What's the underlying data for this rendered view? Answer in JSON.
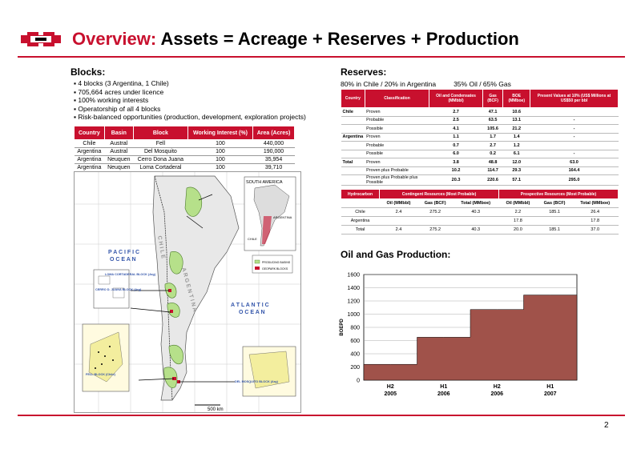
{
  "header": {
    "title_prefix": "Overview:",
    "title_rest": " Assets = Acreage + Reserves + Production",
    "accent_color": "#c8102e"
  },
  "blocks": {
    "title": "Blocks:",
    "bullets": [
      "4 blocks (3 Argentina, 1 Chile)",
      "705,664 acres under licence",
      "100% working interests",
      "Operatorship of all 4 blocks",
      "Risk-balanced opportunities (production, development, exploration projects)"
    ],
    "table": {
      "headers": [
        "Country",
        "Basin",
        "Block",
        "Working Interest (%)",
        "Area (Acres)"
      ],
      "rows": [
        [
          "Chile",
          "Austral",
          "Fell",
          "100",
          "440,000"
        ],
        [
          "Argentina",
          "Austral",
          "Del Mosquito",
          "100",
          "190,000"
        ],
        [
          "Argentina",
          "Neuquen",
          "Cerro Dona Juana",
          "100",
          "35,954"
        ],
        [
          "Argentina",
          "Neuquen",
          "Loma Cortaderal",
          "100",
          "39,710"
        ]
      ]
    }
  },
  "map": {
    "labels": {
      "south_america": "SOUTH AMERICA",
      "argentina_inset": "ARGENTINA",
      "chile_inset": "CHILE",
      "pacific": "P A C I F I C",
      "pacific2": "O C E A N",
      "atlantic": "A T L A N T I C",
      "atlantic2": "O C E A N",
      "chile": "C H I L E",
      "argentina": "A R G E N T I N A",
      "loma": "LOMA CORTADERAL BLOCK (Arg)",
      "cerro": "CERRO D. JUANA BLOCK (Arg)",
      "fell": "FELL BLOCK (Chile)",
      "mosquito": "DEL MOSQUITO BLOCK (Arg)",
      "scale": "500 km",
      "legend1": "PRODUCING BASINS",
      "legend2": "GEOPARK BLOCKS"
    }
  },
  "reserves": {
    "title": "Reserves:",
    "split_location": "80% in Chile / 20% in Argentina",
    "split_type": "35% Oil / 65% Gas",
    "table": {
      "headers": [
        "Country",
        "Classification",
        "Oil and Condensates (MMbbl)",
        "Gas (BCF)",
        "BOE (MMboe)",
        "Present Values at 10% (US$ Millions at US$50 per bbl"
      ],
      "rows": [
        [
          "Chile",
          "Proven",
          "2.7",
          "47.1",
          "10.6",
          ""
        ],
        [
          "",
          "Probable",
          "2.5",
          "63.5",
          "13.1",
          "-"
        ],
        [
          "",
          "Possible",
          "4.1",
          "105.6",
          "21.2",
          "-"
        ],
        [
          "Argentina",
          "Proven",
          "1.1",
          "1.7",
          "1.4",
          "-"
        ],
        [
          "",
          "Probable",
          "0.7",
          "2.7",
          "1.2",
          ""
        ],
        [
          "",
          "Possible",
          "6.0",
          "0.2",
          "6.1",
          "-"
        ],
        [
          "Total",
          "Proven",
          "3.8",
          "48.8",
          "12.0",
          "63.0"
        ],
        [
          "",
          "Proven plus Probable",
          "10.2",
          "114.7",
          "29.3",
          "164.4"
        ],
        [
          "",
          "Proven plus Probable plus Possible",
          "20.3",
          "220.6",
          "57.1",
          "295.0"
        ]
      ]
    },
    "resources": {
      "group_headers": [
        "Hydrocarbon",
        "Contingent Resources (Most Probable)",
        "Prospective Resources (Most Probable)"
      ],
      "sub_headers": [
        "",
        "Oil (MMbbl)",
        "Gas (BCF)",
        "Total (MMboe)",
        "Oil (MMbbl)",
        "Gas (BCF)",
        "Total (MMboe)"
      ],
      "rows": [
        [
          "Chile",
          "2.4",
          "275.2",
          "40.3",
          "2.2",
          "185.1",
          "26.4"
        ],
        [
          "Argentina",
          "",
          "",
          "",
          "17.8",
          "",
          "17.8"
        ],
        [
          "Total",
          "2.4",
          "275.2",
          "40.3",
          "20.0",
          "185.1",
          "37.0"
        ]
      ]
    }
  },
  "production": {
    "title": "Oil and Gas Production:"
  },
  "chart_data": {
    "type": "area",
    "categories": [
      "H2 2005",
      "H1 2006",
      "H2 2006",
      "H1 2007"
    ],
    "tick_labels": [
      [
        "H2",
        "2005"
      ],
      [
        "H1",
        "2006"
      ],
      [
        "H2",
        "2006"
      ],
      [
        "H1",
        "2007"
      ]
    ],
    "x": [
      0,
      0.5,
      1,
      1.5,
      2,
      2.5,
      3,
      3.5,
      4
    ],
    "values": [
      240,
      240,
      650,
      650,
      1070,
      1070,
      1290,
      1290
    ],
    "ylabel": "BOEPD",
    "ylim": [
      0,
      1600
    ],
    "yticks": [
      0,
      200,
      400,
      600,
      800,
      1000,
      1200,
      1400,
      1600
    ],
    "fill_color": "#a0524a",
    "grid": true
  },
  "footer": {
    "page_number": "2"
  }
}
